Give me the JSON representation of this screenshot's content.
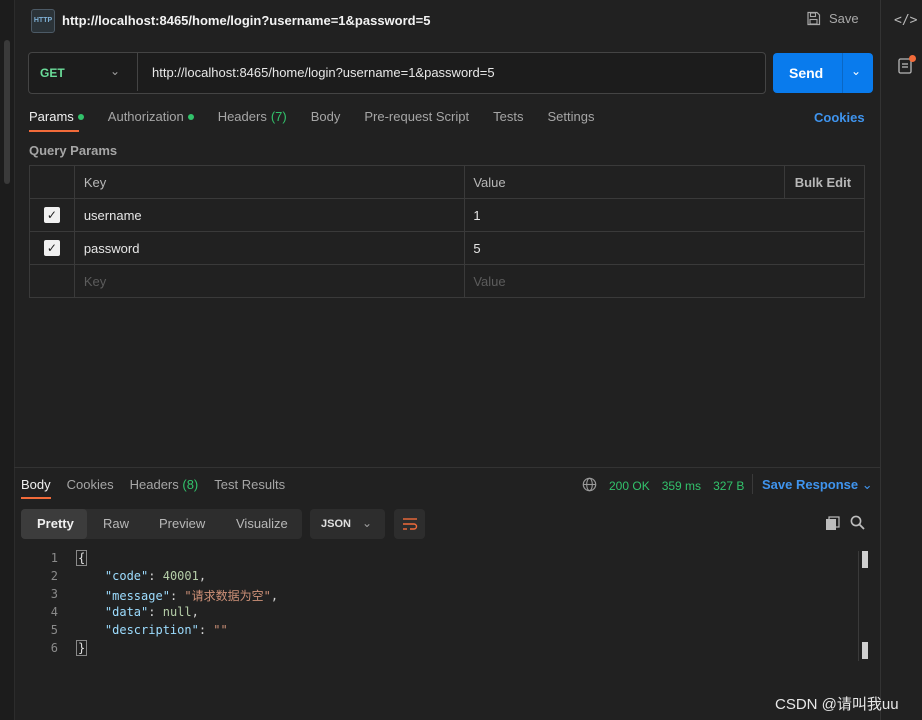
{
  "tab": {
    "title": "http://localhost:8465/home/login?username=1&password=5",
    "save_label": "Save",
    "icon": "HTTP"
  },
  "request": {
    "method": "GET",
    "url": "http://localhost:8465/home/login?username=1&password=5",
    "send_label": "Send"
  },
  "request_tabs": {
    "params": "Params",
    "authorization": "Authorization",
    "headers": "Headers",
    "headers_count": "(7)",
    "body": "Body",
    "pre_request": "Pre-request Script",
    "tests": "Tests",
    "settings": "Settings",
    "cookies": "Cookies"
  },
  "query_params": {
    "title": "Query Params",
    "headers": {
      "key": "Key",
      "value": "Value",
      "bulk_edit": "Bulk Edit"
    },
    "rows": [
      {
        "key": "username",
        "value": "1"
      },
      {
        "key": "password",
        "value": "5"
      }
    ],
    "placeholder": {
      "key": "Key",
      "value": "Value"
    }
  },
  "response_tabs": {
    "body": "Body",
    "cookies": "Cookies",
    "headers": "Headers",
    "headers_count": "(8)",
    "test_results": "Test Results"
  },
  "response_status": {
    "status": "200 OK",
    "time": "359 ms",
    "size": "327 B",
    "save_response": "Save Response"
  },
  "view_modes": {
    "pretty": "Pretty",
    "raw": "Raw",
    "preview": "Preview",
    "visualize": "Visualize",
    "format": "JSON"
  },
  "response_body": {
    "line_numbers": [
      "1",
      "2",
      "3",
      "4",
      "5",
      "6"
    ],
    "open_brace": "{",
    "close_brace": "}",
    "fields": [
      {
        "key": "\"code\"",
        "value": "40001",
        "type": "number",
        "trail": ","
      },
      {
        "key": "\"message\"",
        "value": "\"请求数据为空\"",
        "type": "string",
        "trail": ","
      },
      {
        "key": "\"data\"",
        "value": "null",
        "type": "number",
        "trail": ","
      },
      {
        "key": "\"description\"",
        "value": "\"\"",
        "type": "string",
        "trail": ""
      }
    ]
  },
  "watermark": "CSDN @请叫我uu",
  "colors": {
    "accent": "#f26b3a",
    "send": "#097bed",
    "success": "#32c26b",
    "link": "#3f94ee"
  },
  "icons": [
    "http-icon",
    "save-icon",
    "code-icon",
    "info-icon",
    "globe-icon",
    "copy-icon",
    "search-icon",
    "wrap-icon"
  ]
}
